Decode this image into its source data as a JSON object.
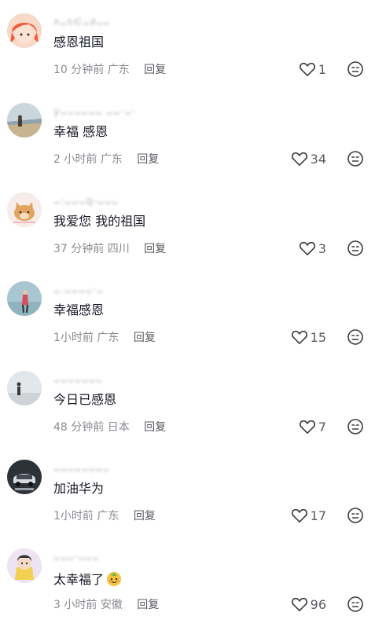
{
  "reply_label": "回复",
  "comments": [
    {
      "username": "ʌᴗs∈ᴗ∂ᴗᴗ",
      "text": "感恩祖国",
      "time": "10 分钟前",
      "location": "广东",
      "likes": "1",
      "avatar": "avatar-red-hair-icon"
    },
    {
      "username": "yᴗᴗᴗᴗᴗᴗ ᴗᴗ·ᴗ·",
      "text": "幸福 感恩",
      "time": "2 小时前",
      "location": "广东",
      "likes": "34",
      "avatar": "avatar-beach-icon"
    },
    {
      "username": "ᴗ:ᴗᴗᴗq-ᴗᴗᴗ",
      "text": "我爱您 我的祖国",
      "time": "37 分钟前",
      "location": "四川",
      "likes": "3",
      "avatar": "avatar-cat-icon"
    },
    {
      "username": "ᴗ.ᴗᴗᴗᴗ·ᴗ",
      "text": "幸福感恩",
      "time": "1小时前",
      "location": "广东",
      "likes": "15",
      "avatar": "avatar-figure-icon"
    },
    {
      "username": "ᴗᴗᴗᴗᴗᴗᴗ",
      "text": "今日已感恩",
      "time": "48 分钟前",
      "location": "日本",
      "likes": "7",
      "avatar": "avatar-person-standing-icon"
    },
    {
      "username": "ᴗᴗᴗᴗᴗᴗᴗᴗ",
      "text": "加油华为",
      "time": "1小时前",
      "location": "广东",
      "likes": "17",
      "avatar": "avatar-car-icon"
    },
    {
      "username": "ᴗᴗᴗ·ᴗᴗᴗ",
      "text": "太幸福了",
      "time": "3 小时前",
      "location": "安徽",
      "likes": "96",
      "avatar": "avatar-cartoon-icon"
    }
  ]
}
